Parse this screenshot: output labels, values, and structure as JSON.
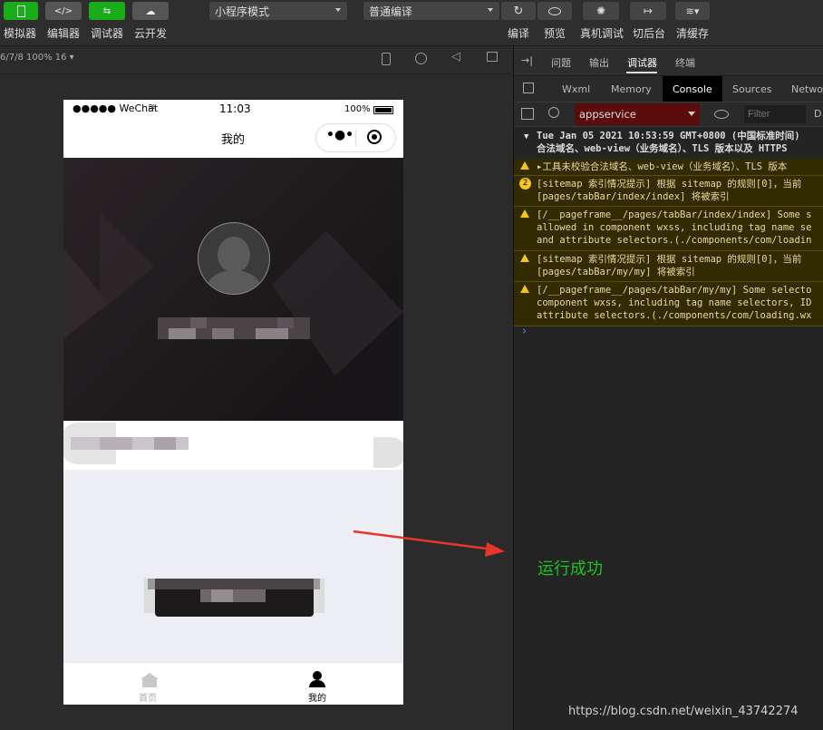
{
  "toolbar": {
    "buttons": [
      {
        "label": "模拟器",
        "icon": "phone-icon"
      },
      {
        "label": "编辑器",
        "icon": "code-icon"
      },
      {
        "label": "调试器",
        "icon": "sliders-icon"
      },
      {
        "label": "云开发",
        "icon": "cloud-icon"
      }
    ],
    "mode_select": "小程序模式",
    "compile_select": "普通编译",
    "right_buttons": [
      {
        "label": "编译",
        "icon": "refresh-icon"
      },
      {
        "label": "预览",
        "icon": "eye-icon"
      },
      {
        "label": "真机调试",
        "icon": "bug-icon"
      },
      {
        "label": "切后台",
        "icon": "switch-icon"
      },
      {
        "label": "清缓存",
        "icon": "layers-icon"
      }
    ]
  },
  "simulator": {
    "device_info": "6/7/8 100% 16",
    "statusbar": {
      "carrier": "●●●●● WeChat",
      "time": "11:03",
      "battery": "100%"
    },
    "page_title": "我的",
    "tabs": [
      {
        "label": "首页"
      },
      {
        "label": "我的"
      }
    ]
  },
  "devtools": {
    "top_tabs": [
      "问题",
      "输出",
      "调试器",
      "终端"
    ],
    "panel_tabs": [
      "Wxml",
      "Memory",
      "Console",
      "Sources",
      "Netwo"
    ],
    "context": "appservice",
    "filter_placeholder": "Filter",
    "filter_tail": "D",
    "group_header_line1": "Tue Jan 05 2021 10:53:59 GMT+0800 (中国标准时间) ",
    "group_header_line2": "合法域名、web-view（业务域名）、TLS 版本以及 HTTPS",
    "logs": [
      {
        "lines": [
          "▸工具未校验合法域名、web-view（业务域名）、TLS 版本"
        ]
      },
      {
        "badge": "2",
        "lines": [
          "[sitemap 索引情况提示] 根据 sitemap 的规则[0]，当前",
          "[pages/tabBar/index/index] 将被索引"
        ]
      },
      {
        "lines": [
          "[/__pageframe__/pages/tabBar/index/index] Some s",
          "allowed in component wxss, including tag name se",
          "and attribute selectors.(./components/com/loadin"
        ]
      },
      {
        "lines": [
          "[sitemap 索引情况提示] 根据 sitemap 的规则[0]，当前",
          "[pages/tabBar/my/my] 将被索引"
        ]
      },
      {
        "lines": [
          "[/__pageframe__/pages/tabBar/my/my] Some selecto",
          "component wxss, including tag name selectors, ID",
          "attribute selectors.(./components/com/loading.wx"
        ]
      }
    ],
    "prompt": "›"
  },
  "annotation": "运行成功",
  "watermark": "https://blog.csdn.net/weixin_43742274",
  "colors": {
    "accent_green": "#1aad19",
    "annotation_red": "#e8352c",
    "annotation_text": "#1ec21e"
  }
}
